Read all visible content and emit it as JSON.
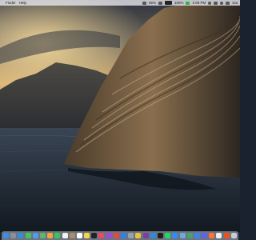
{
  "menubar": {
    "apple": "",
    "app_name": "Finder",
    "menus": [
      "Help"
    ],
    "status": {
      "zoom_percent": "65%",
      "battery_percent": "100%",
      "battery_level": 1.0,
      "time": "1:06 PM",
      "day": "Sat"
    },
    "colors": {
      "bar": "#ebebf0",
      "text": "#1a1a1a"
    }
  },
  "desktop": {
    "wallpaper": "island-cliff-coast",
    "colors": {
      "sky_top": "#3a3f4c",
      "sky_glow": "#f0c67a",
      "sea": "#1b2430",
      "cliff": "#6a5540"
    }
  },
  "dock": {
    "icons": [
      {
        "name": "finder-icon",
        "color": "#3a8ee6"
      },
      {
        "name": "launchpad-icon",
        "color": "#8a8f99"
      },
      {
        "name": "safari-icon",
        "color": "#2e8fe0"
      },
      {
        "name": "messages-icon",
        "color": "#3ec75a"
      },
      {
        "name": "mail-icon",
        "color": "#4f9cf0"
      },
      {
        "name": "maps-icon",
        "color": "#58b86b"
      },
      {
        "name": "photos-icon",
        "color": "#f0a43a"
      },
      {
        "name": "facetime-icon",
        "color": "#34c759"
      },
      {
        "name": "calendar-icon",
        "color": "#f2f2f2"
      },
      {
        "name": "contacts-icon",
        "color": "#b08b62"
      },
      {
        "name": "reminders-icon",
        "color": "#ffffff"
      },
      {
        "name": "notes-icon",
        "color": "#f5d547"
      },
      {
        "name": "tv-icon",
        "color": "#222222"
      },
      {
        "name": "music-icon",
        "color": "#f0466a"
      },
      {
        "name": "podcasts-icon",
        "color": "#9b4bd9"
      },
      {
        "name": "news-icon",
        "color": "#ef4444"
      },
      {
        "name": "app-store-icon",
        "color": "#2f7ff0"
      },
      {
        "name": "system-preferences-icon",
        "color": "#9aa0a8"
      },
      {
        "name": "chrome-icon",
        "color": "#e8c23a"
      },
      {
        "name": "slack-icon",
        "color": "#7b3fa1"
      },
      {
        "name": "vscode-icon",
        "color": "#2a8be0"
      },
      {
        "name": "terminal-icon",
        "color": "#1f1f1f"
      },
      {
        "name": "spotify-icon",
        "color": "#1ed760"
      },
      {
        "name": "zoom-icon",
        "color": "#2d8cff"
      },
      {
        "name": "preview-icon",
        "color": "#6fa8dc"
      },
      {
        "name": "activity-monitor-icon",
        "color": "#48a36a"
      },
      {
        "name": "xcode-icon",
        "color": "#3b82f6"
      },
      {
        "name": "discord-icon",
        "color": "#5865f2"
      },
      {
        "name": "firefox-icon",
        "color": "#ff7139"
      },
      {
        "name": "notion-icon",
        "color": "#eeeeee"
      },
      {
        "name": "figma-icon",
        "color": "#f24e1e"
      },
      {
        "name": "trash-icon",
        "color": "#c8cdd4"
      }
    ]
  }
}
